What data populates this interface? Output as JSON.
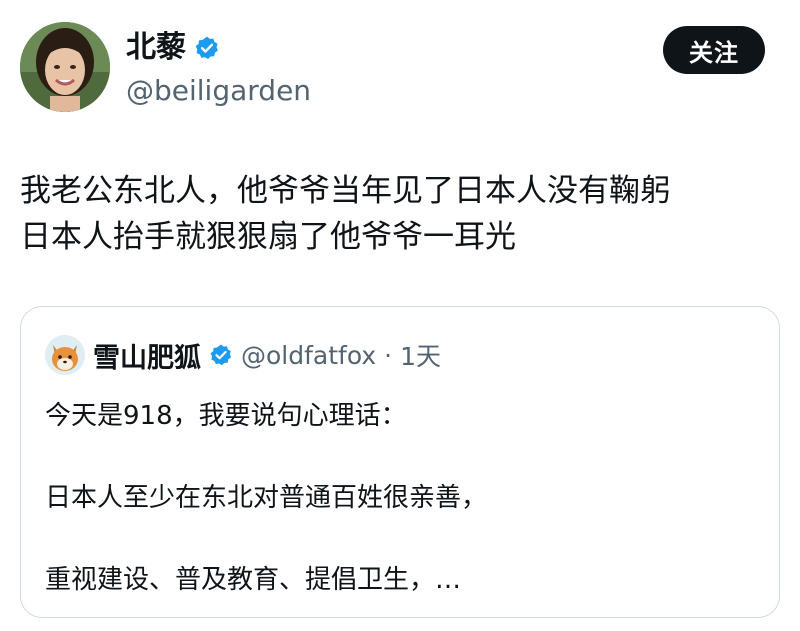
{
  "tweet": {
    "author": {
      "display_name": "北藜",
      "handle": "@beiligarden",
      "verified_badge_icon": "verified-badge-icon",
      "avatar_icon": "avatar-photo"
    },
    "follow_button_label": "关注",
    "text_lines": [
      "我老公东北人，他爷爷当年见了日本人没有鞠躬",
      "日本人抬手就狠狠扇了他爷爷一耳光"
    ],
    "colors": {
      "verified_blue": "#1d9bf0",
      "handle_gray": "#536471",
      "button_bg": "#0f1419"
    }
  },
  "quoted_tweet": {
    "author": {
      "display_name": "雪山肥狐",
      "handle": "@oldfatfox",
      "separator": "·",
      "time": "1天",
      "avatar_icon": "fox-avatar-icon"
    },
    "text_lines": [
      "今天是918，我要说句心理话：",
      "日本人至少在东北对普通百姓很亲善，",
      "重视建设、普及教育、提倡卫生，…"
    ]
  }
}
